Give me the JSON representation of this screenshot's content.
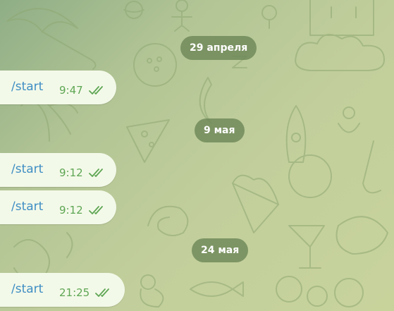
{
  "chat": {
    "separators": [
      {
        "label": "29 апреля"
      },
      {
        "label": "9 мая"
      },
      {
        "label": "24 мая"
      }
    ],
    "messages": [
      {
        "text": "/start",
        "time": "9:47",
        "status_icon": "double-check-icon"
      },
      {
        "text": "/start",
        "time": "9:12",
        "status_icon": "double-check-icon"
      },
      {
        "text": "/start",
        "time": "9:12",
        "status_icon": "double-check-icon"
      },
      {
        "text": "/start",
        "time": "21:25",
        "status_icon": "double-check-icon"
      }
    ]
  },
  "colors": {
    "wallpaper": "#c2cf9c",
    "date_pill": "#6e8758",
    "bubble": "#f3f9e9",
    "command_link": "#3f8ec4",
    "time": "#5ea654"
  }
}
